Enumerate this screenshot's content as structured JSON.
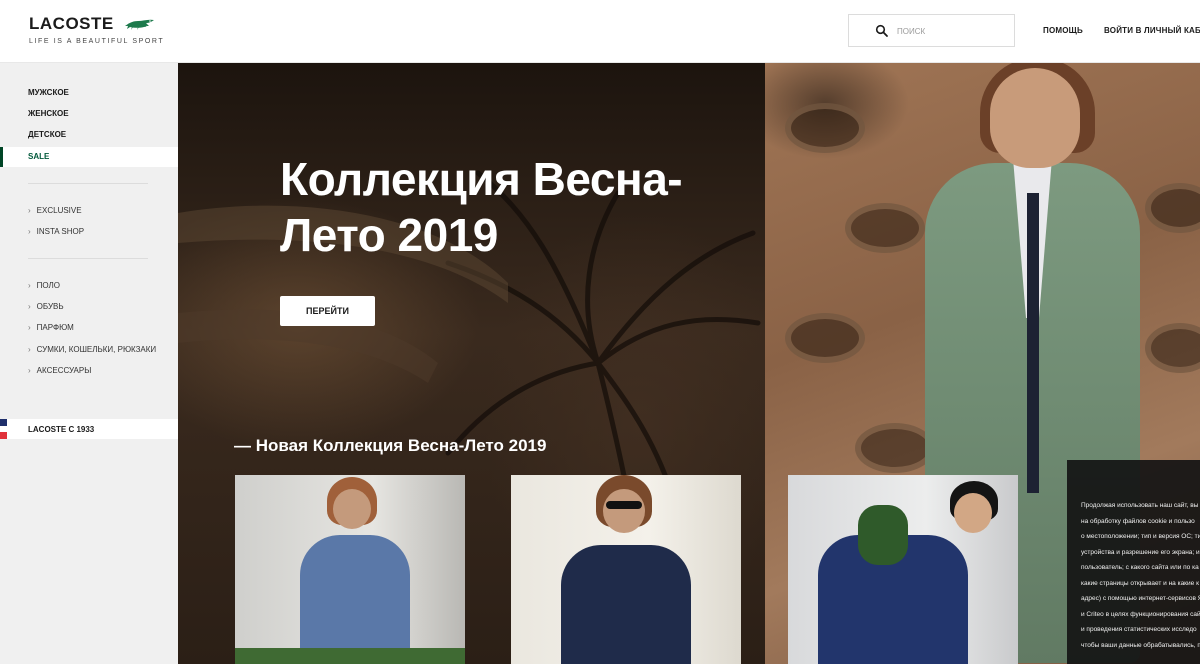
{
  "header": {
    "logo_text": "LACOSTE",
    "tagline": "LIFE IS A BEAUTIFUL SPORT",
    "search_placeholder": "ПОИСК",
    "help_label": "ПОМОЩЬ",
    "login_label": "ВОЙТИ В ЛИЧНЫЙ КАБИНЕТ"
  },
  "sidebar": {
    "main": [
      "МУЖСКОЕ",
      "ЖЕНСКОЕ",
      "ДЕТСКОЕ",
      "SALE"
    ],
    "group1": [
      "EXCLUSIVE",
      "INSTA SHOP"
    ],
    "group2": [
      "ПОЛО",
      "ОБУВЬ",
      "ПАРФЮМ",
      "СУМКИ, КОШЕЛЬКИ, РЮКЗАКИ",
      "АКСЕССУАРЫ"
    ],
    "since": "LACOSTE С 1933"
  },
  "hero": {
    "title": "Коллекция Весна-Лето 2019",
    "button": "ПЕРЕЙТИ",
    "subtitle": "— Новая Коллекция Весна-Лето 2019"
  },
  "cookie": {
    "lines": [
      "Продолжая использовать наш сайт, вы д",
      "на обработку файлов cookie и пользо",
      "о местоположении; тип и версия ОС; ти",
      "устройства и разрешение его экрана; и",
      "пользователь; с какого сайта или по ка",
      "какие страницы открывает и на какие к",
      "адрес) с помощью интернет-сервисов Я",
      "и Criteo в целях функционирования сай",
      "и проведения статистических исследо",
      "чтобы ваши данные обрабатывались, п"
    ]
  },
  "colors": {
    "brand_green": "#004526",
    "croc_green": "#1d7a4c",
    "flag_blue": "#1f2f6b",
    "flag_red": "#e0313a"
  },
  "icons": {
    "logo": "crocodile-logo-icon",
    "search": "search-icon",
    "chevron": "chevron-right-icon"
  }
}
